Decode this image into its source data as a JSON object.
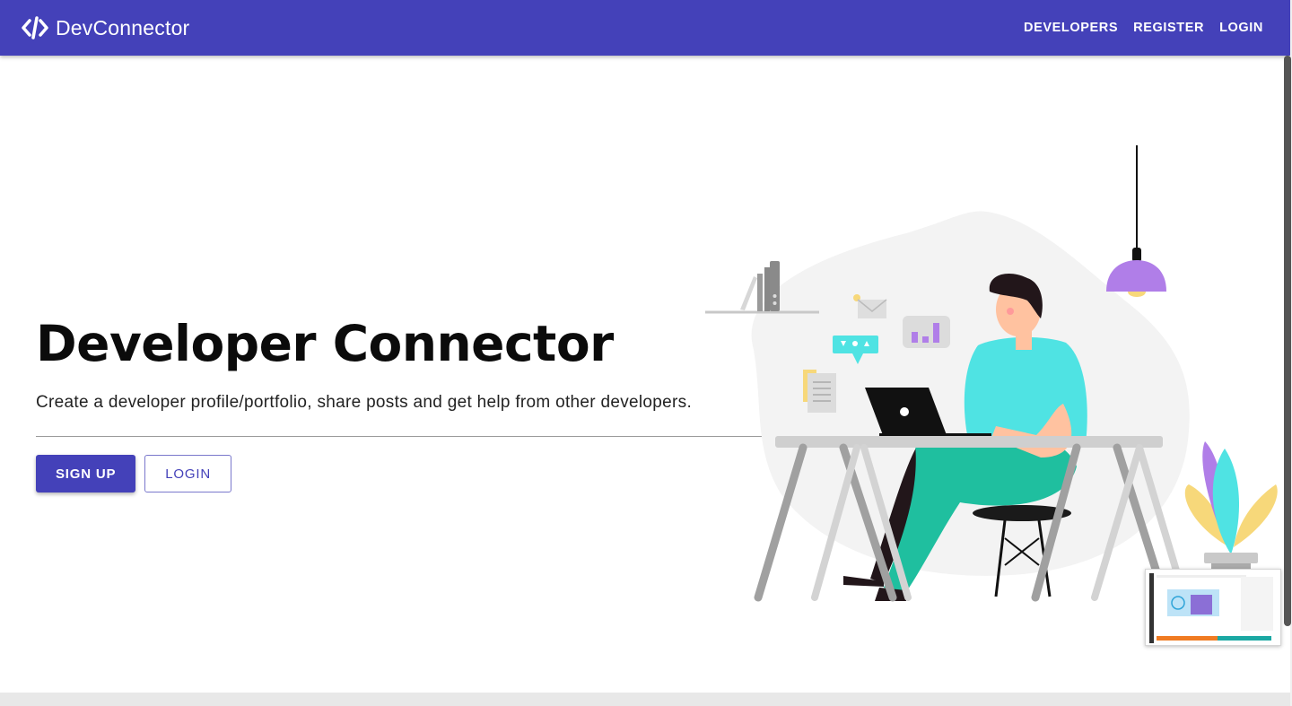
{
  "navbar": {
    "brand": "DevConnector",
    "brand_icon": "code-icon",
    "links": [
      {
        "label": "DEVELOPERS"
      },
      {
        "label": "REGISTER"
      },
      {
        "label": "LOGIN"
      }
    ]
  },
  "hero": {
    "title": "Developer Connector",
    "subtitle": "Create a developer profile/portfolio, share posts and get help from other developers.",
    "buttons": {
      "signup": "SIGN UP",
      "login": "LOGIN"
    }
  },
  "colors": {
    "primary": "#4441b9",
    "shirt": "#4fe3e3",
    "pants": "#1fbf9f",
    "lamp": "#b07ee8"
  },
  "illustration": {
    "name": "developer-at-desk-illustration"
  }
}
